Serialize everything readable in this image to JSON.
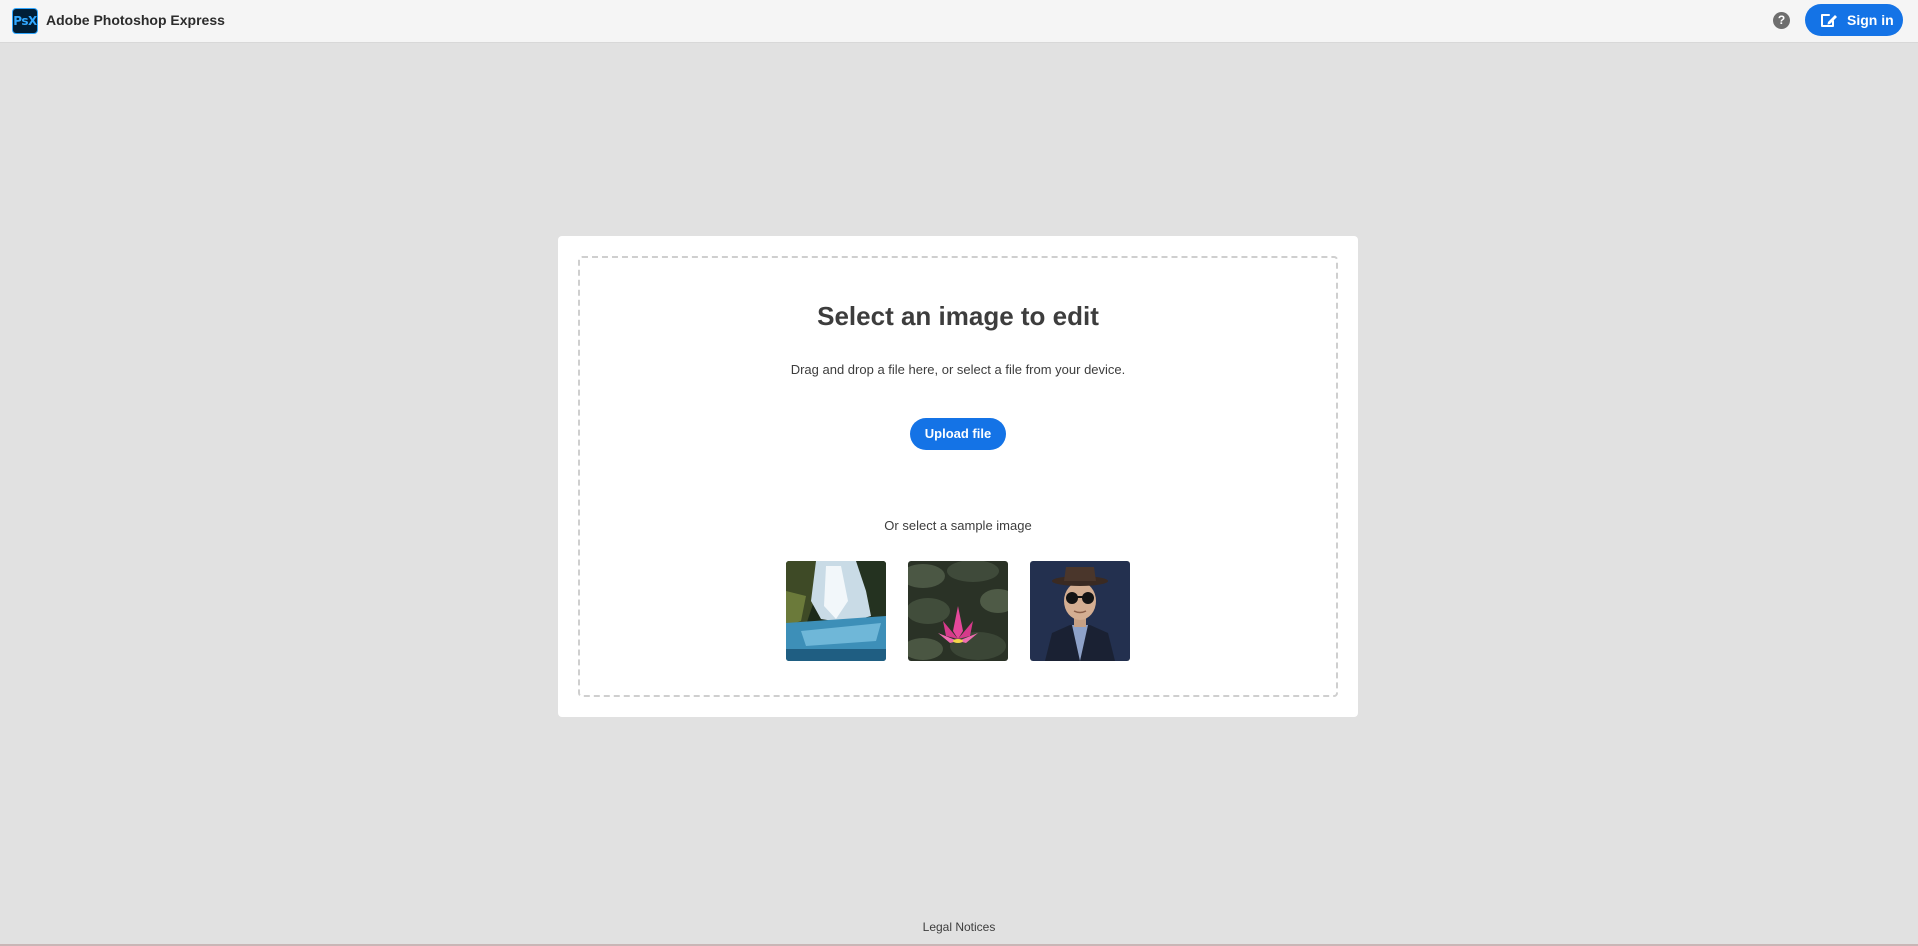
{
  "header": {
    "logo_text": "PsX",
    "app_title": "Adobe Photoshop Express",
    "help_icon": "question-mark-circle-icon",
    "signin_label": "Sign in",
    "signin_icon": "edit-pencil-icon"
  },
  "main": {
    "title": "Select an image to edit",
    "subtitle": "Drag and drop a file here, or select a file from your device.",
    "upload_label": "Upload file",
    "sample_label": "Or select a sample image",
    "samples": [
      {
        "name": "waterfall"
      },
      {
        "name": "water-lily"
      },
      {
        "name": "man-in-hat-with-sunglasses"
      }
    ]
  },
  "footer": {
    "legal_label": "Legal Notices"
  },
  "colors": {
    "accent": "#1473e6",
    "page_background": "#e1e1e1",
    "card_background": "#ffffff",
    "logo_background": "#001e36",
    "logo_text": "#31a8ff"
  }
}
